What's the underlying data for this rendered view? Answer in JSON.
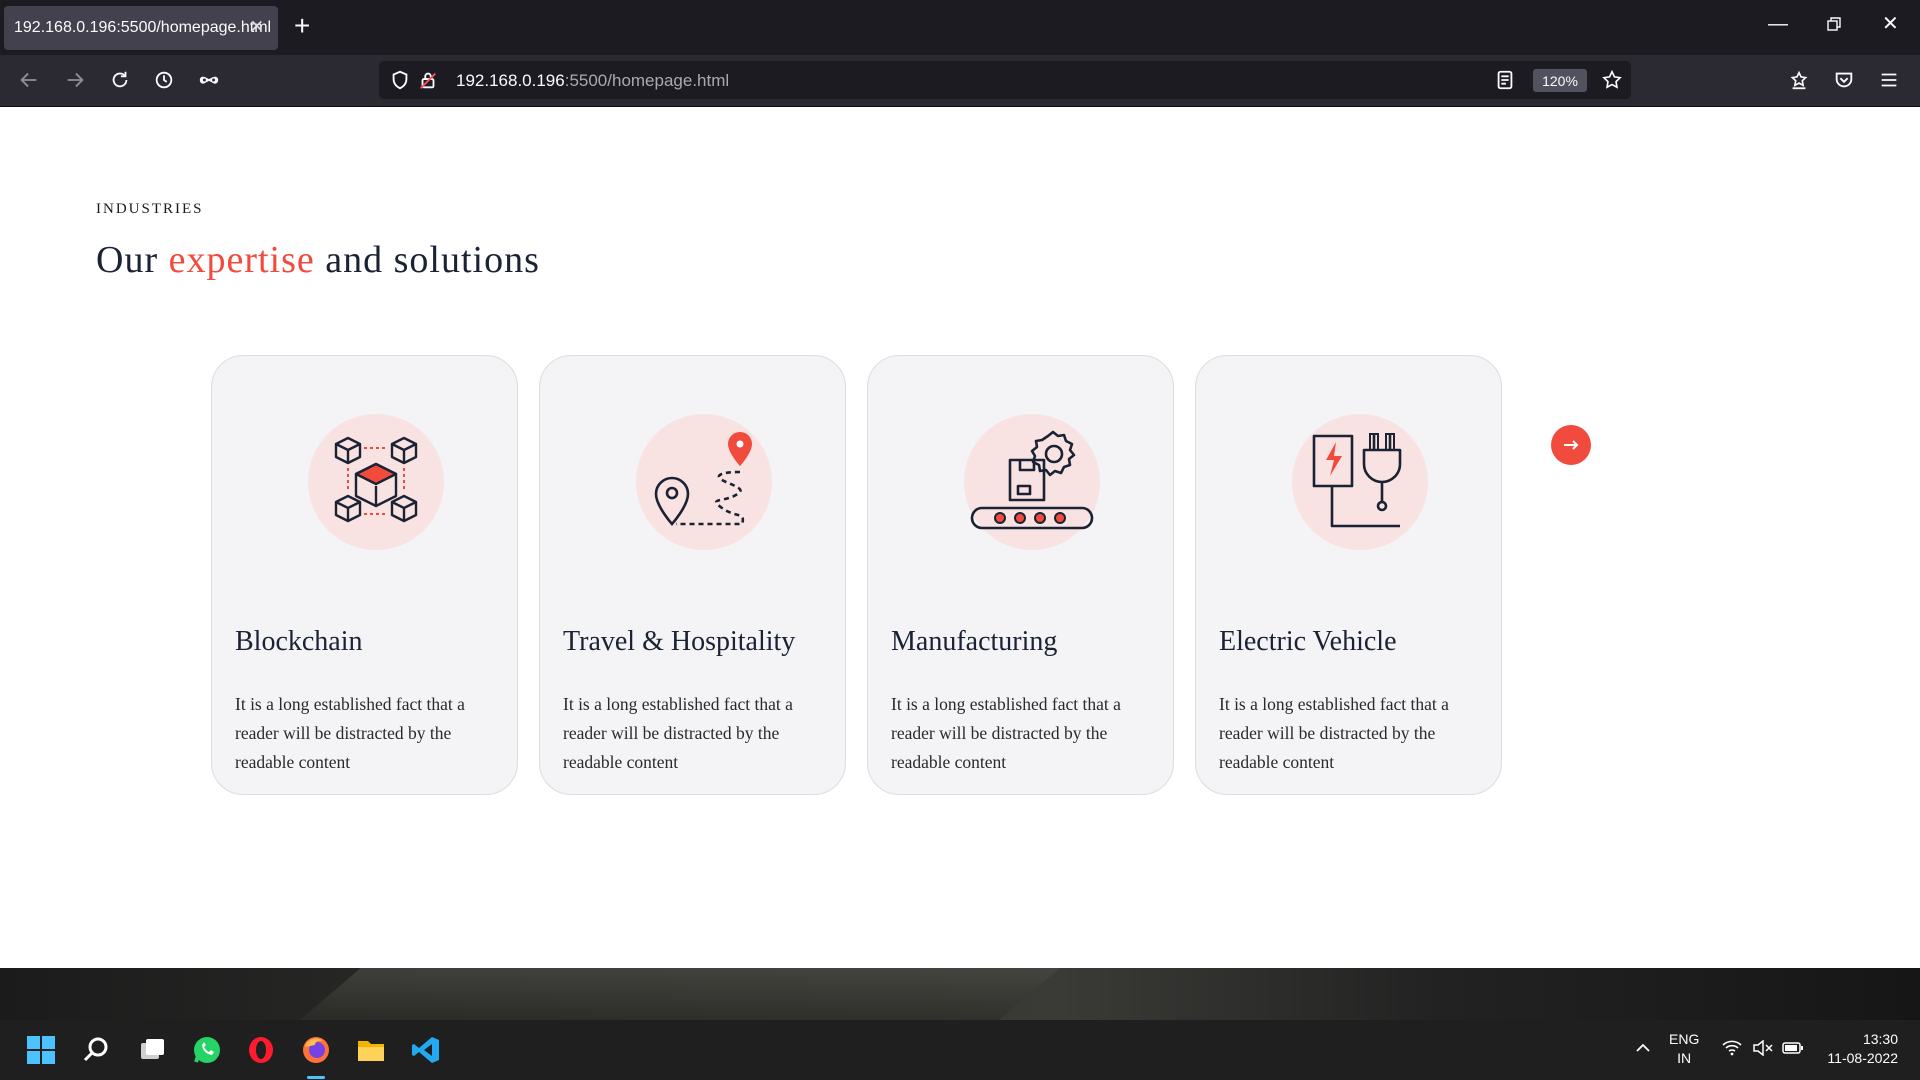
{
  "browser": {
    "tab_title": "192.168.0.196:5500/homepage.html",
    "url_host": "192.168.0.196",
    "url_path": ":5500/homepage.html",
    "zoom": "120%"
  },
  "section": {
    "eyebrow": "INDUSTRIES",
    "heading_before": "Our",
    "heading_accent": "expertise",
    "heading_after": "and solutions",
    "accent_color": "#f04b3c"
  },
  "cards": [
    {
      "title": "Blockchain",
      "icon": "blockchain-icon",
      "desc": "It is a long established fact that a reader will be distracted by the readable content"
    },
    {
      "title": "Travel & Hospitality",
      "icon": "travel-route-icon",
      "desc": "It is a long established fact that a reader will be distracted by the readable content"
    },
    {
      "title": "Manufacturing",
      "icon": "manufacturing-conveyor-icon",
      "desc": "It is a long established fact that a reader will be distracted by the readable content"
    },
    {
      "title": "Electric Vehicle",
      "icon": "ev-charger-plug-icon",
      "desc": "It is a long established fact that a reader will be distracted by the readable content"
    }
  ],
  "taskbar": {
    "lang_top": "ENG",
    "lang_bottom": "IN",
    "time": "13:30",
    "date": "11-08-2022"
  }
}
